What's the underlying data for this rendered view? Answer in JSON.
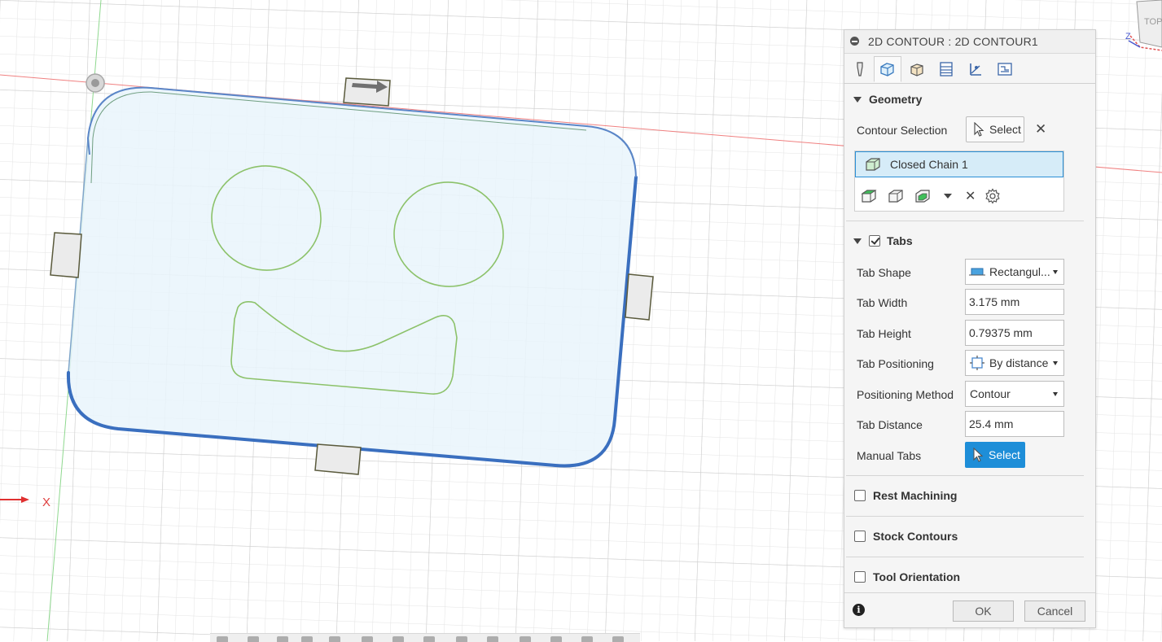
{
  "viewport": {
    "axis_x_label": "X",
    "viewcube": {
      "face_label": "TOP",
      "axis_label": "Z"
    }
  },
  "dialog": {
    "title": "2D CONTOUR : 2D CONTOUR1",
    "tabs": [
      {
        "name": "tool-tab-icon",
        "active": false
      },
      {
        "name": "geometry-tab-icon",
        "active": true
      },
      {
        "name": "heights-tab-icon",
        "active": false
      },
      {
        "name": "passes-tab-icon",
        "active": false
      },
      {
        "name": "linking-tab-icon",
        "active": false
      },
      {
        "name": "post-tab-icon",
        "active": false
      }
    ],
    "geometry": {
      "header": "Geometry",
      "contour_selection_label": "Contour Selection",
      "select_label": "Select",
      "chains": [
        "Closed Chain 1"
      ]
    },
    "tabs_section": {
      "header": "Tabs",
      "enabled": true,
      "tab_shape_label": "Tab Shape",
      "tab_shape_value": "Rectangul...",
      "tab_width_label": "Tab Width",
      "tab_width_value": "3.175 mm",
      "tab_height_label": "Tab Height",
      "tab_height_value": "0.79375 mm",
      "tab_positioning_label": "Tab Positioning",
      "tab_positioning_value": "By distance",
      "positioning_method_label": "Positioning Method",
      "positioning_method_value": "Contour",
      "tab_distance_label": "Tab Distance",
      "tab_distance_value": "25.4 mm",
      "manual_tabs_label": "Manual Tabs",
      "manual_tabs_button": "Select"
    },
    "rest_machining": {
      "label": "Rest Machining",
      "checked": false
    },
    "stock_contours": {
      "label": "Stock Contours",
      "checked": false
    },
    "tool_orientation": {
      "label": "Tool Orientation",
      "checked": false
    },
    "footer": {
      "ok_label": "OK",
      "cancel_label": "Cancel"
    }
  },
  "colors": {
    "accent_blue": "#1e8ed8",
    "contour_blue": "#3a6fbf",
    "sketch_green": "#8cc26a",
    "grid": "#d6d6d6"
  }
}
